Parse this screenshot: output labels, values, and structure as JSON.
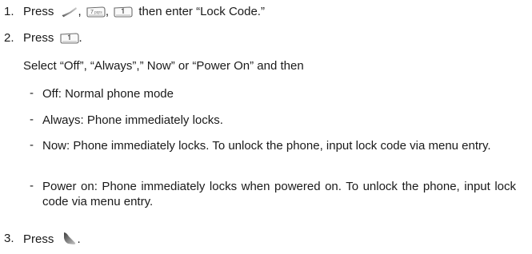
{
  "steps": [
    {
      "number": "1.",
      "prefix": "Press",
      "icons": [
        "send-key-icon",
        "key-7-pqrs-icon",
        "key-1-icon"
      ],
      "suffix": "then enter “Lock Code.”"
    },
    {
      "number": "2.",
      "prefix": "Press",
      "icons": [
        "key-1-icon"
      ],
      "suffix": "."
    },
    {
      "number": "3.",
      "prefix": "Press",
      "icons": [
        "ok-key-icon"
      ],
      "suffix": "."
    }
  ],
  "step2_instruction": "Select “Off”, “Always”,” Now” or “Power On” and then",
  "options": [
    {
      "bullet": "-",
      "text": "Off: Normal phone mode"
    },
    {
      "bullet": "-",
      "text": "Always: Phone immediately locks."
    },
    {
      "bullet": "-",
      "text": "Now: Phone immediately locks. To unlock the phone, input lock code via menu entry."
    },
    {
      "bullet": "-",
      "text": "Power on: Phone immediately locks when powered on. To unlock the phone, input lock code via menu entry."
    }
  ],
  "comma": ","
}
